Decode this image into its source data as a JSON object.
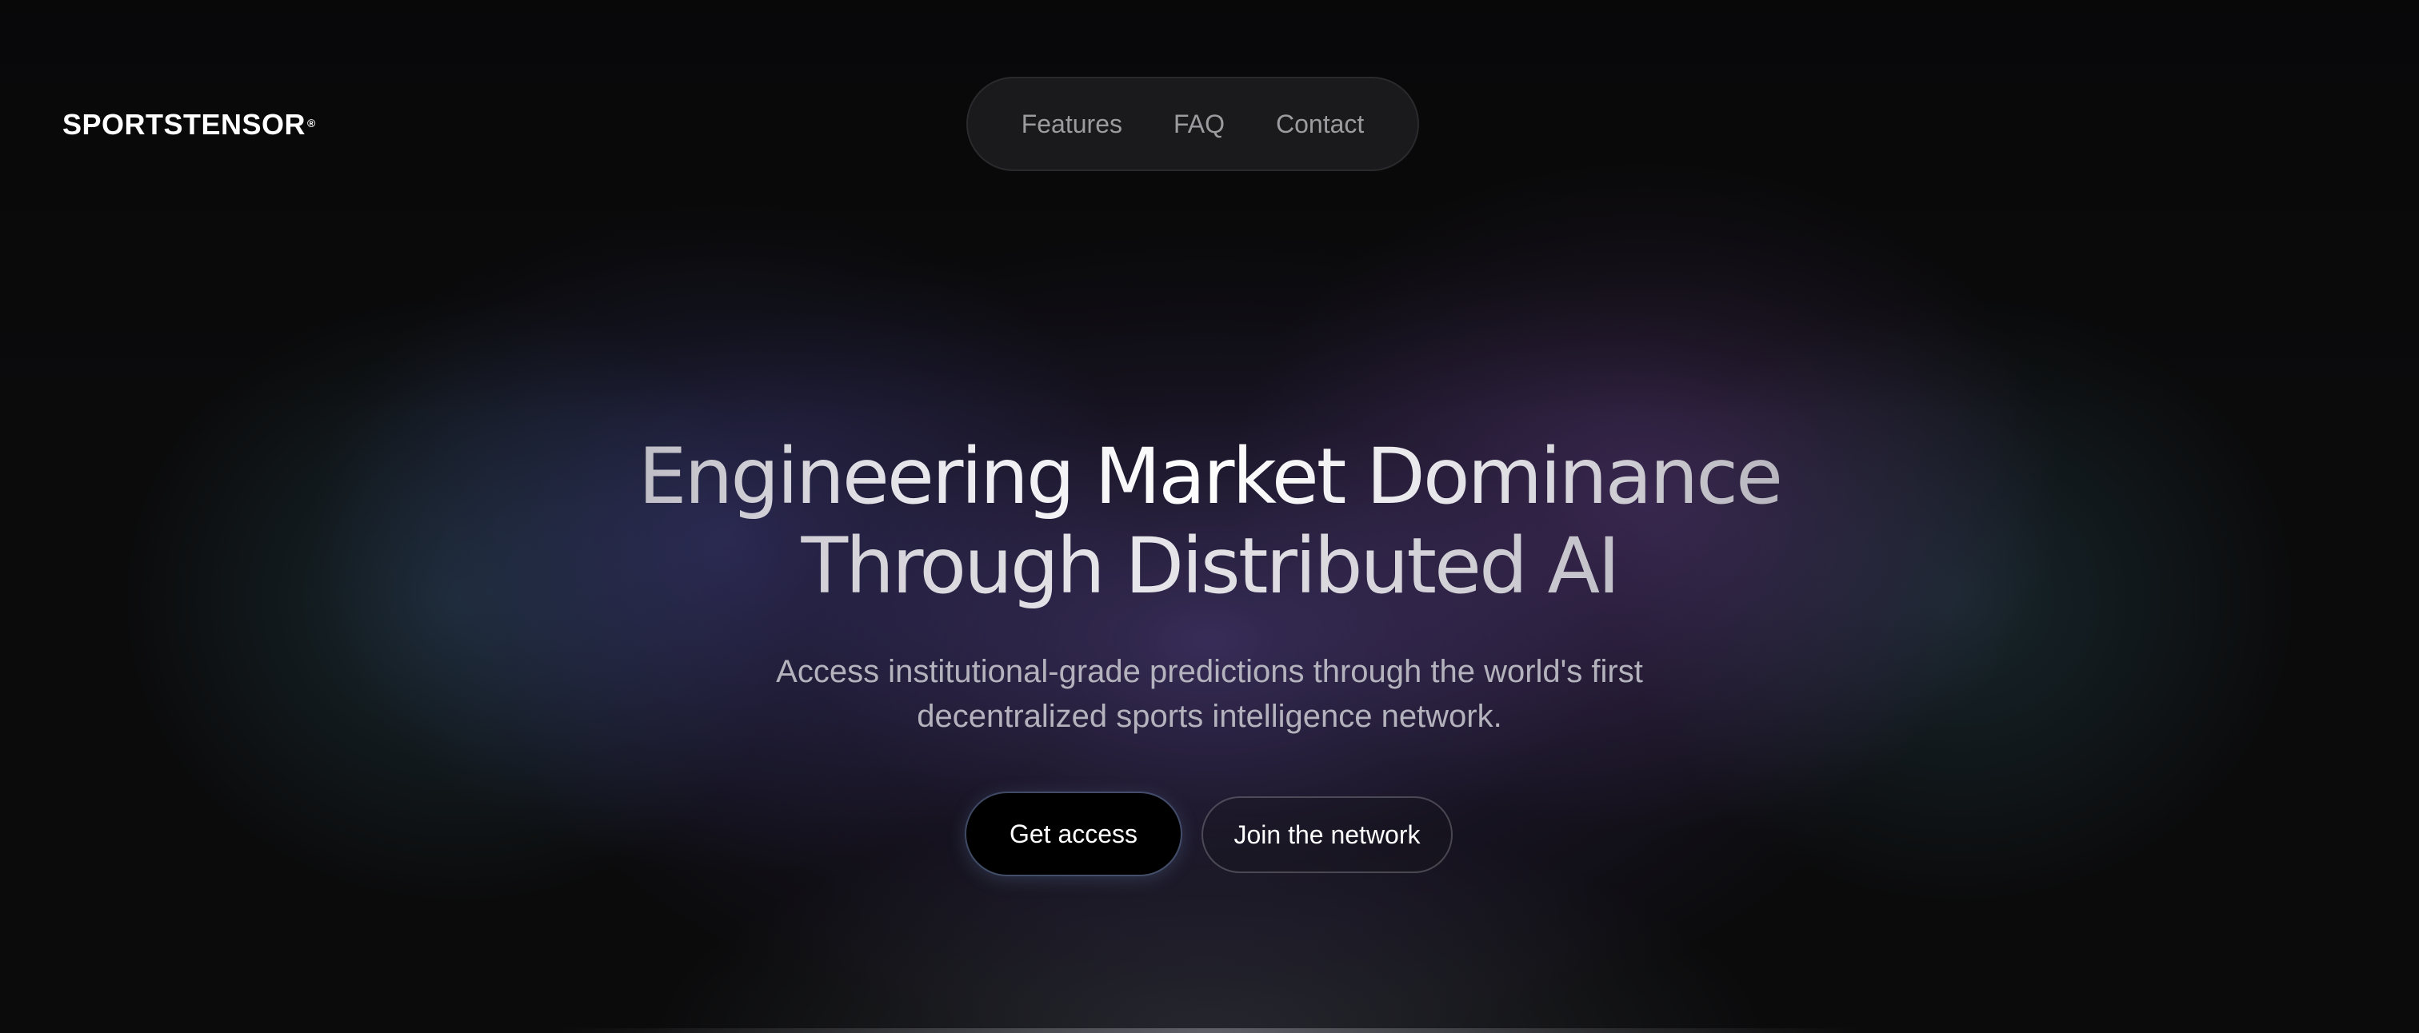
{
  "brand": {
    "name": "SPORTSTENSOR",
    "mark": "®"
  },
  "nav": {
    "items": [
      {
        "label": "Features"
      },
      {
        "label": "FAQ"
      },
      {
        "label": "Contact"
      }
    ]
  },
  "hero": {
    "title_line1_a": "Engineering Market Dominance",
    "title_line2": "Through Distributed AI",
    "subtitle_line1": "Access institutional-grade predictions through the world's first",
    "subtitle_line2": "decentralized sports intelligence network.",
    "primary_cta": "Get access",
    "secondary_cta": "Join the network"
  },
  "colors": {
    "background": "#0b0b0c",
    "glow_purple": "#5c4896",
    "glow_teal": "#325f6e",
    "nav_text": "#9b9ba0",
    "subtitle_text": "#b4b3bd",
    "button_primary_bg": "#000000",
    "button_text": "#ffffff"
  }
}
